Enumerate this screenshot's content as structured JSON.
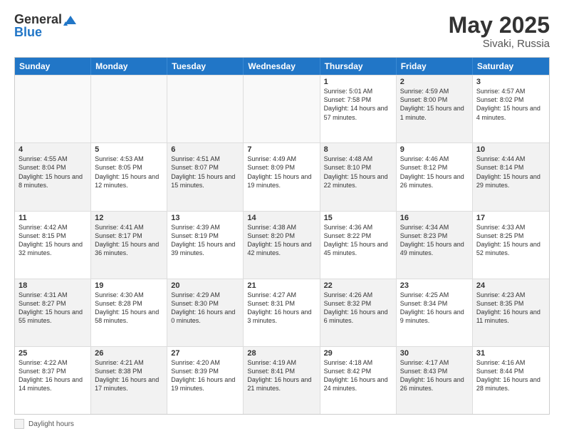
{
  "header": {
    "logo_general": "General",
    "logo_blue": "Blue",
    "month_year": "May 2025",
    "location": "Sivaki, Russia"
  },
  "footer": {
    "label": "Daylight hours"
  },
  "days_of_week": [
    "Sunday",
    "Monday",
    "Tuesday",
    "Wednesday",
    "Thursday",
    "Friday",
    "Saturday"
  ],
  "rows": [
    [
      {
        "day": "",
        "sunrise": "",
        "sunset": "",
        "daylight": "",
        "shaded": false,
        "empty": true
      },
      {
        "day": "",
        "sunrise": "",
        "sunset": "",
        "daylight": "",
        "shaded": false,
        "empty": true
      },
      {
        "day": "",
        "sunrise": "",
        "sunset": "",
        "daylight": "",
        "shaded": false,
        "empty": true
      },
      {
        "day": "",
        "sunrise": "",
        "sunset": "",
        "daylight": "",
        "shaded": false,
        "empty": true
      },
      {
        "day": "1",
        "sunrise": "Sunrise: 5:01 AM",
        "sunset": "Sunset: 7:58 PM",
        "daylight": "Daylight: 14 hours and 57 minutes.",
        "shaded": false,
        "empty": false
      },
      {
        "day": "2",
        "sunrise": "Sunrise: 4:59 AM",
        "sunset": "Sunset: 8:00 PM",
        "daylight": "Daylight: 15 hours and 1 minute.",
        "shaded": true,
        "empty": false
      },
      {
        "day": "3",
        "sunrise": "Sunrise: 4:57 AM",
        "sunset": "Sunset: 8:02 PM",
        "daylight": "Daylight: 15 hours and 4 minutes.",
        "shaded": false,
        "empty": false
      }
    ],
    [
      {
        "day": "4",
        "sunrise": "Sunrise: 4:55 AM",
        "sunset": "Sunset: 8:04 PM",
        "daylight": "Daylight: 15 hours and 8 minutes.",
        "shaded": true,
        "empty": false
      },
      {
        "day": "5",
        "sunrise": "Sunrise: 4:53 AM",
        "sunset": "Sunset: 8:05 PM",
        "daylight": "Daylight: 15 hours and 12 minutes.",
        "shaded": false,
        "empty": false
      },
      {
        "day": "6",
        "sunrise": "Sunrise: 4:51 AM",
        "sunset": "Sunset: 8:07 PM",
        "daylight": "Daylight: 15 hours and 15 minutes.",
        "shaded": true,
        "empty": false
      },
      {
        "day": "7",
        "sunrise": "Sunrise: 4:49 AM",
        "sunset": "Sunset: 8:09 PM",
        "daylight": "Daylight: 15 hours and 19 minutes.",
        "shaded": false,
        "empty": false
      },
      {
        "day": "8",
        "sunrise": "Sunrise: 4:48 AM",
        "sunset": "Sunset: 8:10 PM",
        "daylight": "Daylight: 15 hours and 22 minutes.",
        "shaded": true,
        "empty": false
      },
      {
        "day": "9",
        "sunrise": "Sunrise: 4:46 AM",
        "sunset": "Sunset: 8:12 PM",
        "daylight": "Daylight: 15 hours and 26 minutes.",
        "shaded": false,
        "empty": false
      },
      {
        "day": "10",
        "sunrise": "Sunrise: 4:44 AM",
        "sunset": "Sunset: 8:14 PM",
        "daylight": "Daylight: 15 hours and 29 minutes.",
        "shaded": true,
        "empty": false
      }
    ],
    [
      {
        "day": "11",
        "sunrise": "Sunrise: 4:42 AM",
        "sunset": "Sunset: 8:15 PM",
        "daylight": "Daylight: 15 hours and 32 minutes.",
        "shaded": false,
        "empty": false
      },
      {
        "day": "12",
        "sunrise": "Sunrise: 4:41 AM",
        "sunset": "Sunset: 8:17 PM",
        "daylight": "Daylight: 15 hours and 36 minutes.",
        "shaded": true,
        "empty": false
      },
      {
        "day": "13",
        "sunrise": "Sunrise: 4:39 AM",
        "sunset": "Sunset: 8:19 PM",
        "daylight": "Daylight: 15 hours and 39 minutes.",
        "shaded": false,
        "empty": false
      },
      {
        "day": "14",
        "sunrise": "Sunrise: 4:38 AM",
        "sunset": "Sunset: 8:20 PM",
        "daylight": "Daylight: 15 hours and 42 minutes.",
        "shaded": true,
        "empty": false
      },
      {
        "day": "15",
        "sunrise": "Sunrise: 4:36 AM",
        "sunset": "Sunset: 8:22 PM",
        "daylight": "Daylight: 15 hours and 45 minutes.",
        "shaded": false,
        "empty": false
      },
      {
        "day": "16",
        "sunrise": "Sunrise: 4:34 AM",
        "sunset": "Sunset: 8:23 PM",
        "daylight": "Daylight: 15 hours and 49 minutes.",
        "shaded": true,
        "empty": false
      },
      {
        "day": "17",
        "sunrise": "Sunrise: 4:33 AM",
        "sunset": "Sunset: 8:25 PM",
        "daylight": "Daylight: 15 hours and 52 minutes.",
        "shaded": false,
        "empty": false
      }
    ],
    [
      {
        "day": "18",
        "sunrise": "Sunrise: 4:31 AM",
        "sunset": "Sunset: 8:27 PM",
        "daylight": "Daylight: 15 hours and 55 minutes.",
        "shaded": true,
        "empty": false
      },
      {
        "day": "19",
        "sunrise": "Sunrise: 4:30 AM",
        "sunset": "Sunset: 8:28 PM",
        "daylight": "Daylight: 15 hours and 58 minutes.",
        "shaded": false,
        "empty": false
      },
      {
        "day": "20",
        "sunrise": "Sunrise: 4:29 AM",
        "sunset": "Sunset: 8:30 PM",
        "daylight": "Daylight: 16 hours and 0 minutes.",
        "shaded": true,
        "empty": false
      },
      {
        "day": "21",
        "sunrise": "Sunrise: 4:27 AM",
        "sunset": "Sunset: 8:31 PM",
        "daylight": "Daylight: 16 hours and 3 minutes.",
        "shaded": false,
        "empty": false
      },
      {
        "day": "22",
        "sunrise": "Sunrise: 4:26 AM",
        "sunset": "Sunset: 8:32 PM",
        "daylight": "Daylight: 16 hours and 6 minutes.",
        "shaded": true,
        "empty": false
      },
      {
        "day": "23",
        "sunrise": "Sunrise: 4:25 AM",
        "sunset": "Sunset: 8:34 PM",
        "daylight": "Daylight: 16 hours and 9 minutes.",
        "shaded": false,
        "empty": false
      },
      {
        "day": "24",
        "sunrise": "Sunrise: 4:23 AM",
        "sunset": "Sunset: 8:35 PM",
        "daylight": "Daylight: 16 hours and 11 minutes.",
        "shaded": true,
        "empty": false
      }
    ],
    [
      {
        "day": "25",
        "sunrise": "Sunrise: 4:22 AM",
        "sunset": "Sunset: 8:37 PM",
        "daylight": "Daylight: 16 hours and 14 minutes.",
        "shaded": false,
        "empty": false
      },
      {
        "day": "26",
        "sunrise": "Sunrise: 4:21 AM",
        "sunset": "Sunset: 8:38 PM",
        "daylight": "Daylight: 16 hours and 17 minutes.",
        "shaded": true,
        "empty": false
      },
      {
        "day": "27",
        "sunrise": "Sunrise: 4:20 AM",
        "sunset": "Sunset: 8:39 PM",
        "daylight": "Daylight: 16 hours and 19 minutes.",
        "shaded": false,
        "empty": false
      },
      {
        "day": "28",
        "sunrise": "Sunrise: 4:19 AM",
        "sunset": "Sunset: 8:41 PM",
        "daylight": "Daylight: 16 hours and 21 minutes.",
        "shaded": true,
        "empty": false
      },
      {
        "day": "29",
        "sunrise": "Sunrise: 4:18 AM",
        "sunset": "Sunset: 8:42 PM",
        "daylight": "Daylight: 16 hours and 24 minutes.",
        "shaded": false,
        "empty": false
      },
      {
        "day": "30",
        "sunrise": "Sunrise: 4:17 AM",
        "sunset": "Sunset: 8:43 PM",
        "daylight": "Daylight: 16 hours and 26 minutes.",
        "shaded": true,
        "empty": false
      },
      {
        "day": "31",
        "sunrise": "Sunrise: 4:16 AM",
        "sunset": "Sunset: 8:44 PM",
        "daylight": "Daylight: 16 hours and 28 minutes.",
        "shaded": false,
        "empty": false
      }
    ]
  ]
}
